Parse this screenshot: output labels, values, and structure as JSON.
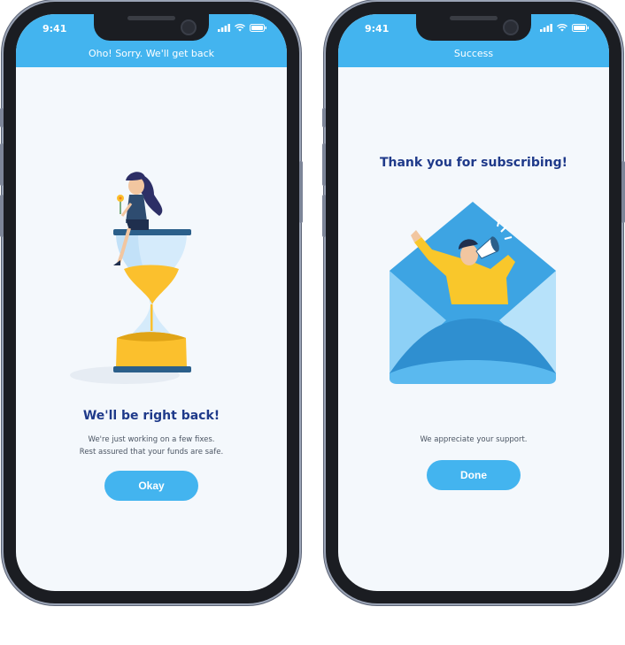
{
  "left_screen": {
    "status_time": "9:41",
    "header_title": "Oho! Sorry. We'll get back",
    "heading": "We'll be right back!",
    "message_line1": "We're just working on a few fixes.",
    "message_line2": "Rest assured that your funds are safe.",
    "button_label": "Okay"
  },
  "right_screen": {
    "status_time": "9:41",
    "header_title": "Success",
    "heading": "Thank you for subscribing!",
    "message": "We appreciate your support.",
    "button_label": "Done"
  },
  "colors": {
    "accent": "#43b4ef",
    "heading": "#1f3a8a",
    "hourglass_sand": "#fbc02d",
    "person_shirt": "#f9c72b"
  },
  "icons": [
    "signal-icon",
    "wifi-icon",
    "battery-icon",
    "hourglass-illustration",
    "envelope-megaphone-illustration"
  ]
}
